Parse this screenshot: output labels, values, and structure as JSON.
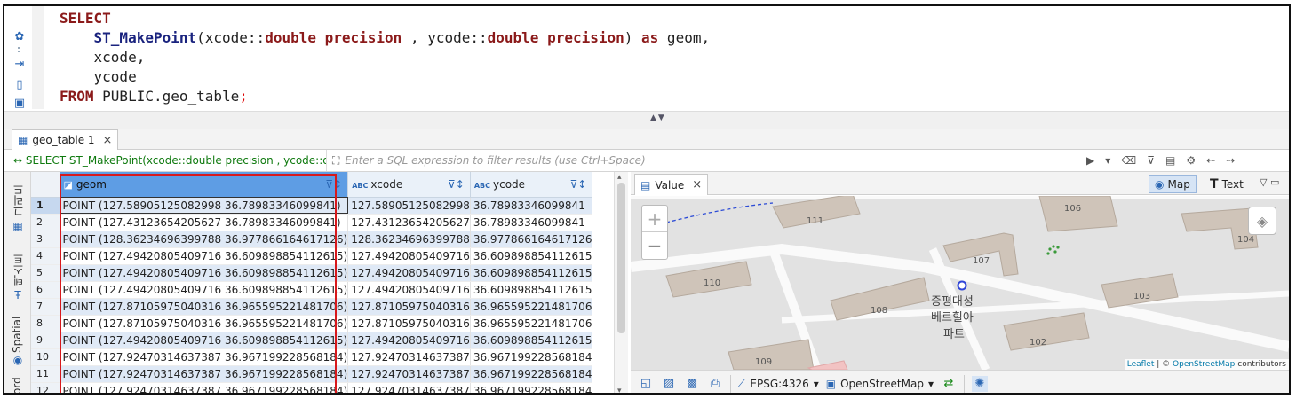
{
  "editor": {
    "lines": [
      [
        {
          "t": "SELECT",
          "c": "kw"
        }
      ],
      [
        {
          "t": "    "
        },
        {
          "t": "ST_MakePoint",
          "c": "fn"
        },
        {
          "t": "(xcode::"
        },
        {
          "t": "double precision",
          "c": "kw"
        },
        {
          "t": " , ycode::"
        },
        {
          "t": "double precision",
          "c": "kw"
        },
        {
          "t": ") "
        },
        {
          "t": "as",
          "c": "kw"
        },
        {
          "t": " geom,"
        }
      ],
      [
        {
          "t": "    xcode,"
        }
      ],
      [
        {
          "t": "    ycode"
        }
      ],
      [
        {
          "t": "FROM",
          "c": "kw"
        },
        {
          "t": " PUBLIC.geo_table"
        },
        {
          "t": ";",
          "c": "semi"
        }
      ]
    ],
    "hscroll_glyph": "‹"
  },
  "result_tab": {
    "label": "geo_table 1",
    "close": "×"
  },
  "filter": {
    "query_label": "SELECT ST_MakePoint(xcode::double precision , ycode::double",
    "placeholder": "Enter a SQL expression to filter results (use Ctrl+Space)"
  },
  "side_tabs": {
    "grid": "그리드",
    "text": "텍스트",
    "spatial": "Spatial",
    "record": "ord"
  },
  "grid": {
    "columns": [
      {
        "name": "geom",
        "type_badge": ""
      },
      {
        "name": "xcode",
        "type_badge": "ABC"
      },
      {
        "name": "ycode",
        "type_badge": "ABC"
      }
    ],
    "rows": [
      {
        "n": "1",
        "geom": "POINT (127.58905125082998 36.78983346099841)",
        "xcode": "127.58905125082998",
        "ycode": "36.78983346099841"
      },
      {
        "n": "2",
        "geom": "POINT (127.43123654205627 36.78983346099841)",
        "xcode": "127.43123654205627",
        "ycode": "36.78983346099841"
      },
      {
        "n": "3",
        "geom": "POINT (128.36234696399788 36.977866164617126)",
        "xcode": "128.36234696399788",
        "ycode": "36.977866164617126"
      },
      {
        "n": "4",
        "geom": "POINT (127.49420805409716 36.609898854112615)",
        "xcode": "127.49420805409716",
        "ycode": "36.609898854112615"
      },
      {
        "n": "5",
        "geom": "POINT (127.49420805409716 36.609898854112615)",
        "xcode": "127.49420805409716",
        "ycode": "36.609898854112615"
      },
      {
        "n": "6",
        "geom": "POINT (127.49420805409716 36.609898854112615)",
        "xcode": "127.49420805409716",
        "ycode": "36.609898854112615"
      },
      {
        "n": "7",
        "geom": "POINT (127.87105975040316 36.965595221481706)",
        "xcode": "127.87105975040316",
        "ycode": "36.965595221481706"
      },
      {
        "n": "8",
        "geom": "POINT (127.87105975040316 36.965595221481706)",
        "xcode": "127.87105975040316",
        "ycode": "36.965595221481706"
      },
      {
        "n": "9",
        "geom": "POINT (127.49420805409716 36.609898854112615)",
        "xcode": "127.49420805409716",
        "ycode": "36.609898854112615"
      },
      {
        "n": "10",
        "geom": "POINT (127.92470314637387 36.967199228568184)",
        "xcode": "127.92470314637387",
        "ycode": "36.967199228568184"
      },
      {
        "n": "11",
        "geom": "POINT (127.92470314637387 36.967199228568184)",
        "xcode": "127.92470314637387",
        "ycode": "36.967199228568184"
      },
      {
        "n": "12",
        "geom": "POINT (127.92470314637387 36.967199228568184)",
        "xcode": "127.92470314637387",
        "ycode": "36.967199228568184"
      }
    ]
  },
  "value_panel": {
    "tab_label": "Value",
    "map_button": "Map",
    "text_button": "Text",
    "zoom_in": "+",
    "zoom_out": "−",
    "buildings": [
      "111",
      "106",
      "104",
      "107",
      "110",
      "108",
      "103",
      "102",
      "109"
    ],
    "place_name": [
      "증평대성",
      "베르힐아",
      "파트"
    ],
    "attribution": {
      "leaflet": "Leaflet",
      "sep": " | © ",
      "osm": "OpenStreetMap",
      "suffix": " contributors"
    }
  },
  "map_toolbar": {
    "crs": "EPSG:4326",
    "tiles": "OpenStreetMap"
  },
  "colors": {
    "selection_box": "#d7191c",
    "geom_header": "#5e9de4",
    "keyword": "#8b1a1a",
    "function": "#1a237e",
    "query_label": "#0f7a0f"
  }
}
